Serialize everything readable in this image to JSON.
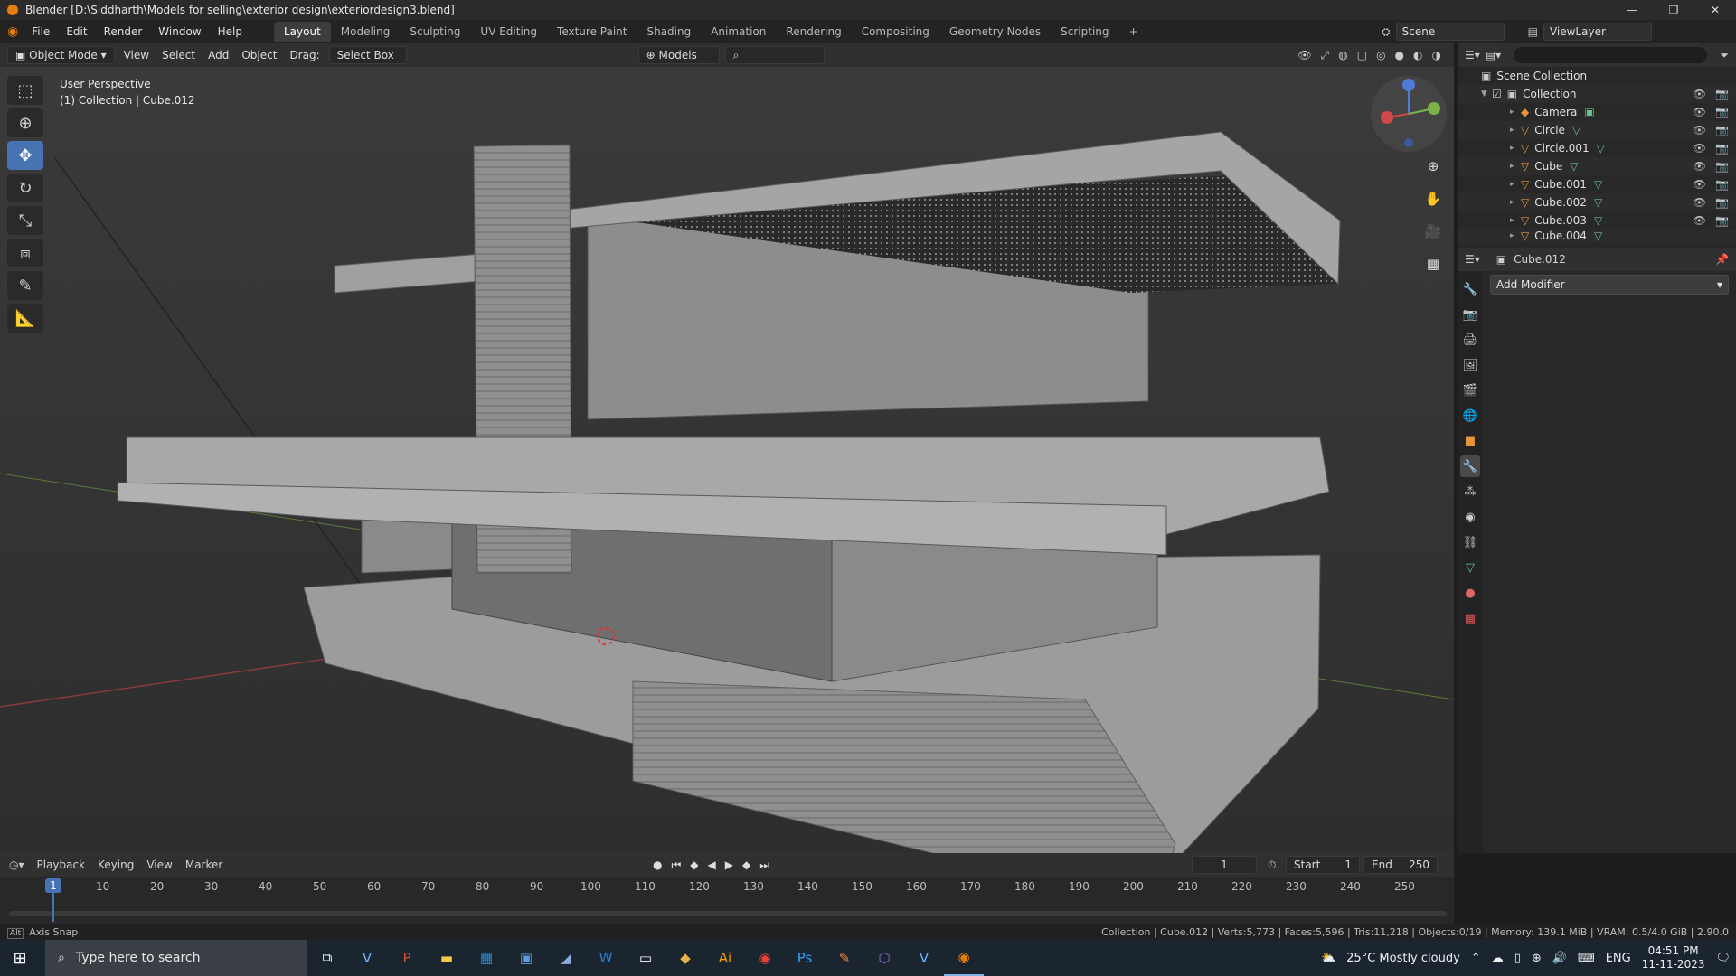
{
  "window": {
    "title": "Blender [D:\\Siddharth\\Models for selling\\exterior design\\exteriordesign3.blend]",
    "controls": [
      "—",
      "❐",
      "✕"
    ]
  },
  "menubar": {
    "menus": [
      "File",
      "Edit",
      "Render",
      "Window",
      "Help"
    ],
    "workspaces": [
      "Layout",
      "Modeling",
      "Sculpting",
      "UV Editing",
      "Texture Paint",
      "Shading",
      "Animation",
      "Rendering",
      "Compositing",
      "Geometry Nodes",
      "Scripting"
    ],
    "active_workspace": "Layout",
    "add_tab": "+",
    "scene": "Scene",
    "view_layer": "ViewLayer"
  },
  "viewport_header": {
    "mode": "Object Mode",
    "items": [
      "View",
      "Select",
      "Add",
      "Object"
    ],
    "drag_label": "Drag:",
    "drag_value": "Select Box",
    "orientation": "Models"
  },
  "viewport": {
    "perspective": "User Perspective",
    "collection_info": "(1) Collection | Cube.012"
  },
  "outliner": {
    "root": "Scene Collection",
    "collection": "Collection",
    "items": [
      "Camera",
      "Circle",
      "Circle.001",
      "Cube",
      "Cube.001",
      "Cube.002",
      "Cube.003",
      "Cube.004"
    ]
  },
  "properties": {
    "object_name": "Cube.012",
    "add_modifier": "Add Modifier"
  },
  "timeline": {
    "menus": [
      "Playback",
      "Keying",
      "View",
      "Marker"
    ],
    "current_frame": "1",
    "start_label": "Start",
    "start": "1",
    "end_label": "End",
    "end": "250",
    "ticks": [
      "10",
      "20",
      "30",
      "40",
      "50",
      "60",
      "70",
      "80",
      "90",
      "100",
      "110",
      "120",
      "130",
      "140",
      "150",
      "160",
      "170",
      "180",
      "190",
      "200",
      "210",
      "220",
      "230",
      "240",
      "250"
    ]
  },
  "statusbar": {
    "left": "Axis Snap",
    "right": "Collection | Cube.012 | Verts:5,773 | Faces:5,596 | Tris:11,218 | Objects:0/19 | Memory: 139.1 MiB | VRAM: 0.5/4.0 GiB | 2.90.0"
  },
  "taskbar": {
    "search_placeholder": "Type here to search",
    "weather": "25°C  Mostly cloudy",
    "language": "ENG",
    "time": "04:51 PM",
    "date": "11-11-2023"
  }
}
